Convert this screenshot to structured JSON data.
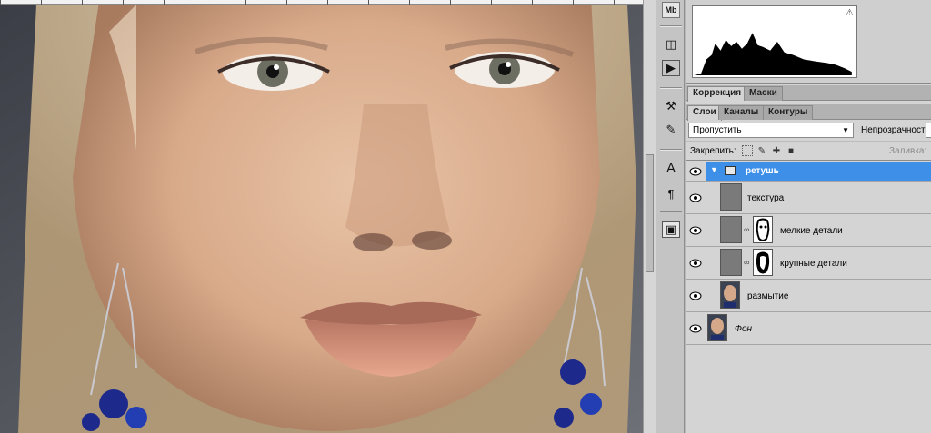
{
  "panels": {
    "tabs_top": [
      {
        "label": "Коррекция",
        "active": true
      },
      {
        "label": "Маски",
        "active": false
      }
    ],
    "tabs_layers": [
      {
        "label": "Слои",
        "active": true
      },
      {
        "label": "Каналы",
        "active": false
      },
      {
        "label": "Контуры",
        "active": false
      }
    ],
    "blend_mode": "Пропустить",
    "opacity_label": "Непрозрачность:",
    "lock_label": "Закрепить:",
    "fill_label": "Заливка:"
  },
  "layers": [
    {
      "name": "ретушь",
      "type": "group",
      "selected": true,
      "visible": true
    },
    {
      "name": "текстура",
      "type": "gray",
      "visible": true
    },
    {
      "name": "мелкие детали",
      "type": "gray-mask",
      "visible": true
    },
    {
      "name": "крупные детали",
      "type": "gray-mask",
      "visible": true
    },
    {
      "name": "размытие",
      "type": "photo",
      "visible": true
    },
    {
      "name": "Фон",
      "type": "photo",
      "visible": true,
      "italic": true
    }
  ],
  "toolstrip": {
    "icons": [
      "mini-bridge-icon",
      "layer-comps-icon",
      "play-actions-icon",
      "clone-source-icon",
      "brush-preset-icon",
      "character-icon",
      "paragraph-icon",
      "navigator-icon"
    ],
    "mb_label": "Mb"
  },
  "colors": {
    "selection": "#3d8fe8",
    "panel_bg": "#d4d4d4",
    "tab_bg": "#b2b2b2"
  }
}
